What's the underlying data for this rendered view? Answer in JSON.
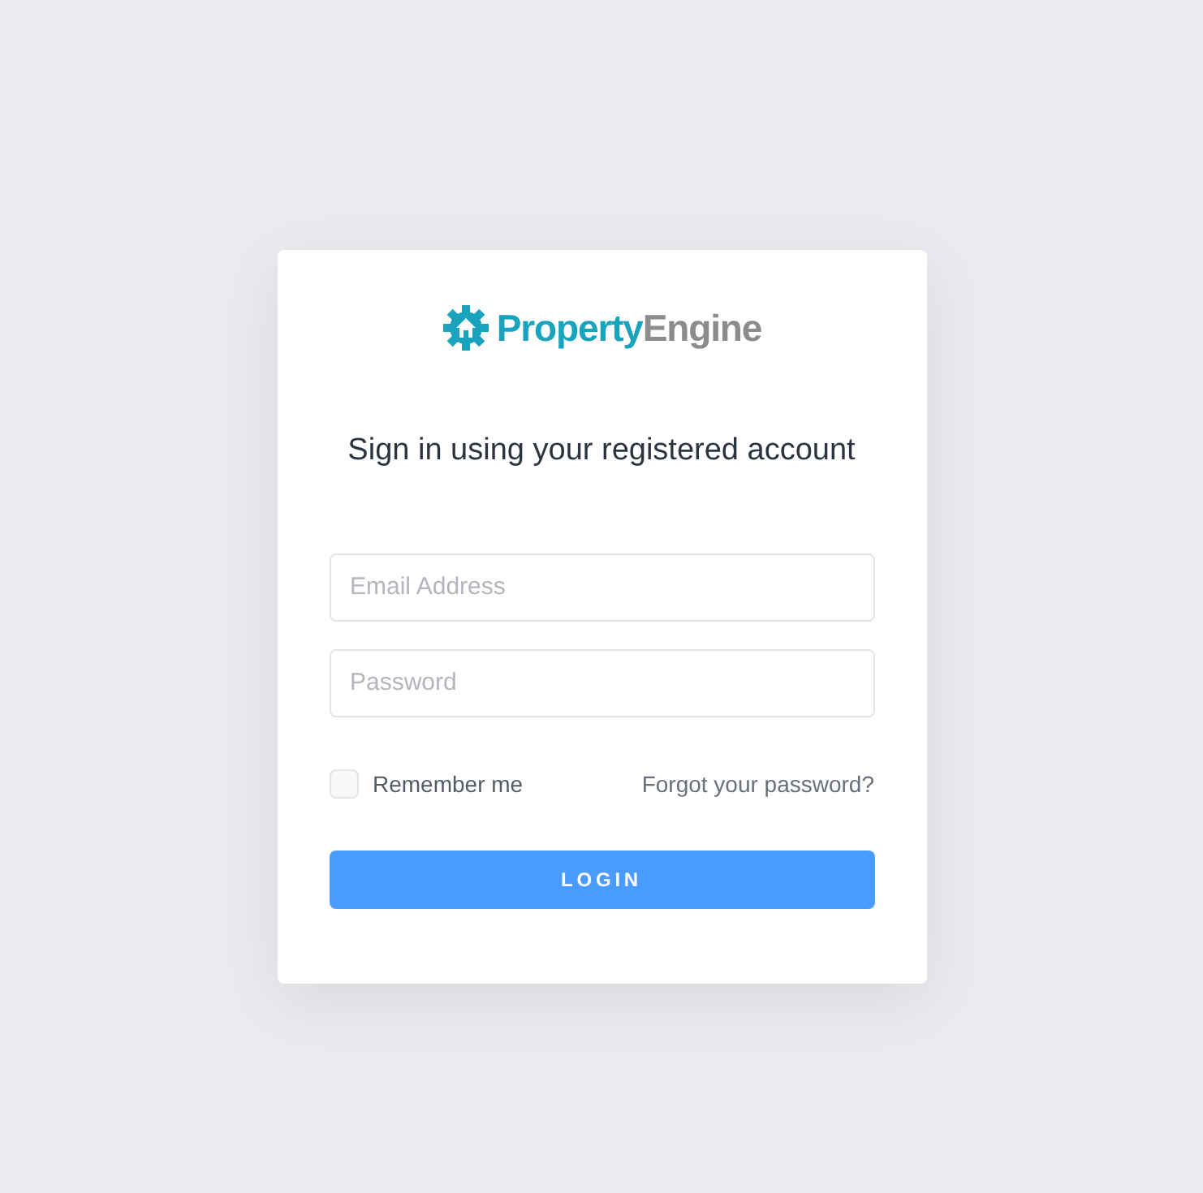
{
  "logo": {
    "primary": "Property",
    "secondary": "Engine"
  },
  "heading": "Sign in using your registered account",
  "fields": [
    {
      "placeholder": "Email Address"
    },
    {
      "placeholder": "Password"
    }
  ],
  "remember": {
    "label": "Remember me",
    "checked": false
  },
  "forgot_link": "Forgot your password?",
  "login_button": "LOGIN"
}
